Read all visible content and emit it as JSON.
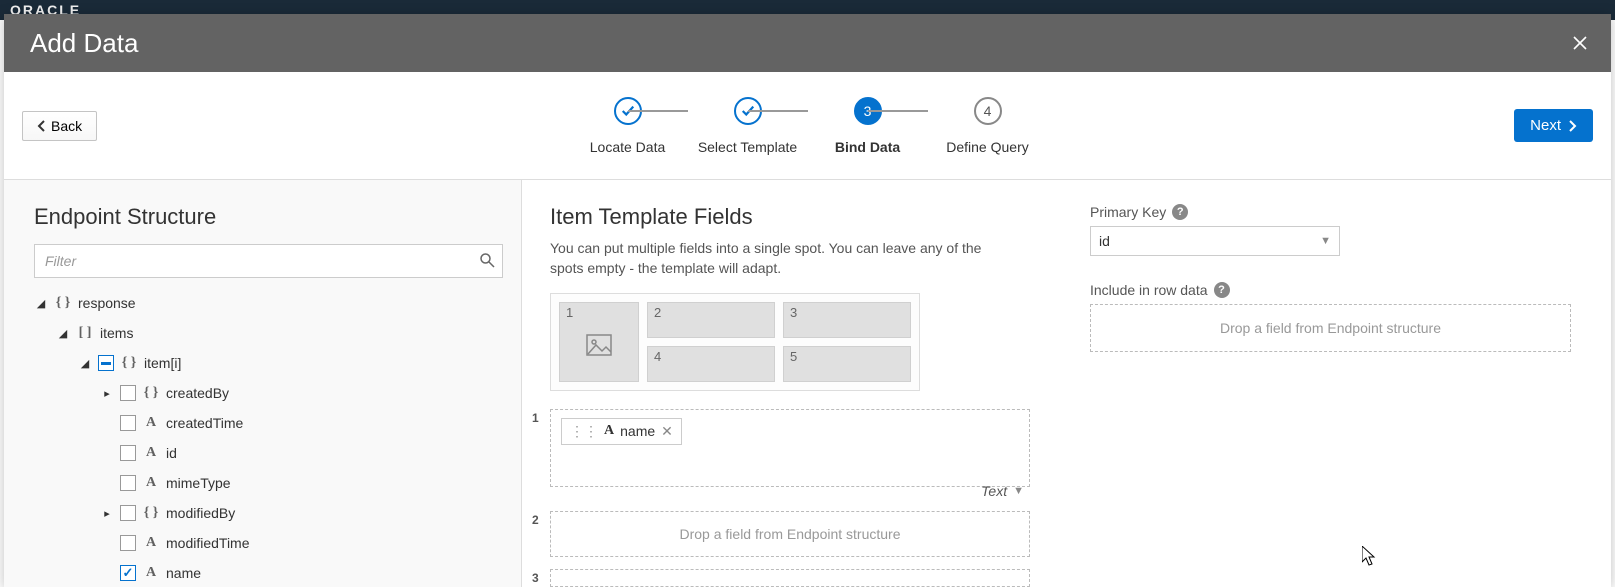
{
  "header": {
    "title": "Add Data"
  },
  "buttons": {
    "back": "Back",
    "next": "Next"
  },
  "stepper": {
    "steps": [
      {
        "label": "Locate Data",
        "state": "done"
      },
      {
        "label": "Select Template",
        "state": "done"
      },
      {
        "label": "Bind Data",
        "state": "active",
        "num": "3"
      },
      {
        "label": "Define Query",
        "state": "pending",
        "num": "4"
      }
    ]
  },
  "left": {
    "title": "Endpoint Structure",
    "filterPlaceholder": "Filter",
    "tree": {
      "response": "response",
      "items": "items",
      "itemi": "item[i]",
      "createdBy": "createdBy",
      "createdTime": "createdTime",
      "id": "id",
      "mimeType": "mimeType",
      "modifiedBy": "modifiedBy",
      "modifiedTime": "modifiedTime",
      "name": "name"
    }
  },
  "main": {
    "title": "Item Template Fields",
    "desc": "You can put multiple fields into a single spot. You can leave any of the spots empty - the template will adapt.",
    "slotNumbers": {
      "s1": "1",
      "s2": "2",
      "s3": "3",
      "s4": "4",
      "s5": "5"
    },
    "slot1": {
      "num": "1",
      "chipLabel": "name",
      "typeLabel": "Text"
    },
    "slot2": {
      "num": "2",
      "placeholder": "Drop a field from Endpoint structure"
    },
    "slot3": {
      "num": "3"
    }
  },
  "side": {
    "pkLabel": "Primary Key",
    "pkValue": "id",
    "rowDataLabel": "Include in row data",
    "rowDataPlaceholder": "Drop a field from Endpoint structure"
  }
}
